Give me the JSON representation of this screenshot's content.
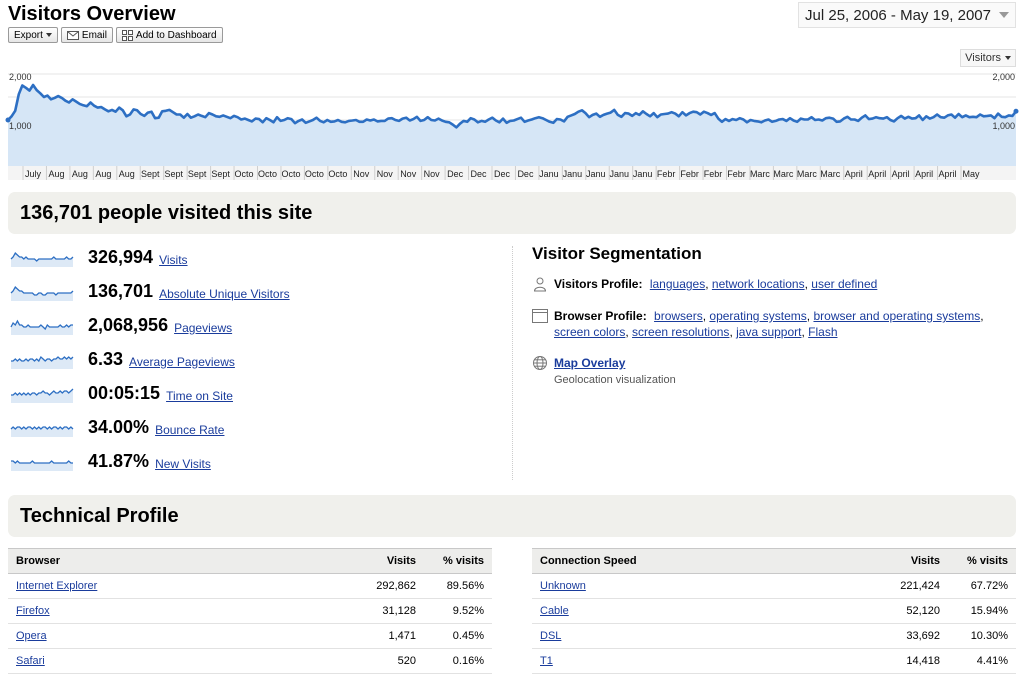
{
  "header": {
    "title": "Visitors Overview",
    "date_range": "Jul 25, 2006 - May 19, 2007",
    "metric_select": "Visitors"
  },
  "toolbar": {
    "export": "Export",
    "email": "Email",
    "add_dashboard": "Add to Dashboard"
  },
  "chart_data": {
    "type": "area",
    "series": [
      {
        "name": "Visitors",
        "values": [
          1000,
          1080,
          1200,
          1560,
          1750,
          1700,
          1640,
          1760,
          1650,
          1580,
          1500,
          1530,
          1450,
          1480,
          1520,
          1480,
          1420,
          1380,
          1450,
          1400,
          1350,
          1320,
          1300,
          1380,
          1310,
          1270,
          1280,
          1230,
          1190,
          1220,
          1180,
          1270,
          1210,
          1080,
          1120,
          1230,
          1210,
          1130,
          1090,
          1160,
          1180,
          1040,
          1050,
          1190,
          1200,
          1220,
          1170,
          1120,
          1120,
          1050,
          1130,
          1050,
          1080,
          1120,
          1090,
          1060,
          1150,
          1120,
          1080,
          1070,
          1100,
          1070,
          1040,
          1090,
          1060,
          1010,
          1030,
          1000,
          970,
          1030,
          1020,
          950,
          1040,
          1000,
          950,
          1060,
          980,
          1000,
          1040,
          1020,
          930,
          980,
          1010,
          940,
          970,
          1000,
          1050,
          980,
          950,
          1000,
          960,
          970,
          1000,
          960,
          950,
          980,
          990,
          1000,
          960,
          960,
          1010,
          990,
          1010,
          970,
          980,
          980,
          1030,
          1040,
          1000,
          980,
          1030,
          1050,
          990,
          1020,
          1070,
          980,
          1000,
          1060,
          1000,
          990,
          1030,
          990,
          960,
          950,
          900,
          840,
          920,
          980,
          960,
          1040,
          1010,
          950,
          980,
          960,
          1010,
          1050,
          990,
          950,
          1030,
          940,
          980,
          990,
          1020,
          1050,
          960,
          990,
          1010,
          1040,
          1060,
          1040,
          1000,
          960,
          940,
          1020,
          1010,
          970,
          1070,
          1100,
          1130,
          1180,
          1210,
          1150,
          1060,
          1110,
          1140,
          1070,
          1110,
          1140,
          1160,
          1220,
          1110,
          1070,
          1150,
          1140,
          1090,
          1150,
          1110,
          1190,
          1130,
          1080,
          1150,
          1060,
          1120,
          1130,
          1140,
          1170,
          1140,
          1080,
          1170,
          1100,
          1150,
          1180,
          1170,
          1120,
          1180,
          1150,
          1110,
          1150,
          1030,
          960,
          1020,
          980,
          1020,
          1000,
          1040,
          1010,
          950,
          1000,
          980,
          970,
          950,
          990,
          1010,
          960,
          980,
          1010,
          1020,
          980,
          1040,
          990,
          960,
          1030,
          1010,
          1010,
          1060,
          1000,
          1010,
          990,
          1040,
          1050,
          1030,
          960,
          970,
          1030,
          1070,
          1010,
          1010,
          980,
          1050,
          1100,
          1020,
          1030,
          1060,
          1040,
          1030,
          1060,
          1000,
          970,
          1040,
          1090,
          1030,
          1070,
          1030,
          1040,
          1100,
          1000,
          1080,
          1030,
          1060,
          1120,
          1060,
          1050,
          1100,
          1120,
          1050,
          1130,
          1060,
          1100,
          1060,
          1070,
          1060,
          1120,
          1080,
          1090,
          1100,
          1040,
          1140,
          1070,
          1060,
          1100,
          1090,
          1190
        ]
      }
    ],
    "ylim": [
      0,
      2000
    ],
    "y_ticks_left": [
      "2,000",
      "1,000"
    ],
    "y_ticks_right": [
      "2,000",
      "1,000"
    ],
    "x_tick_labels": [
      "July",
      "Aug",
      "Aug",
      "Aug",
      "Aug",
      "Sept",
      "Sept",
      "Sept",
      "Sept",
      "Octo",
      "Octo",
      "Octo",
      "Octo",
      "Octo",
      "Nov",
      "Nov",
      "Nov",
      "Nov",
      "Dec",
      "Dec",
      "Dec",
      "Dec",
      "Janu",
      "Janu",
      "Janu",
      "Janu",
      "Janu",
      "Febr",
      "Febr",
      "Febr",
      "Febr",
      "Marc",
      "Marc",
      "Marc",
      "Marc",
      "April",
      "April",
      "April",
      "April",
      "April",
      "May"
    ],
    "grid": true,
    "color": "#2d6fc3"
  },
  "visited_banner": "136,701 people visited this site",
  "metrics": [
    {
      "value": "326,994",
      "label": "Visits",
      "spark": [
        5,
        6,
        8,
        7,
        6,
        6,
        5,
        6,
        5,
        5,
        5,
        5,
        4,
        5,
        5,
        5,
        5,
        5,
        5,
        5,
        6,
        5,
        5,
        5,
        5,
        5,
        6,
        5,
        5,
        6
      ]
    },
    {
      "value": "136,701",
      "label": "Absolute Unique Visitors",
      "spark": [
        5,
        6,
        8,
        7,
        6,
        6,
        5,
        5,
        5,
        5,
        5,
        4,
        4,
        5,
        5,
        4,
        4,
        5,
        5,
        5,
        5,
        4,
        5,
        5,
        5,
        5,
        5,
        5,
        5,
        6
      ]
    },
    {
      "value": "2,068,956",
      "label": "Pageviews",
      "spark": [
        5,
        7,
        6,
        8,
        6,
        6,
        5,
        5,
        6,
        5,
        5,
        5,
        5,
        5,
        6,
        5,
        4,
        6,
        5,
        5,
        5,
        5,
        5,
        6,
        5,
        5,
        6,
        5,
        6,
        6
      ]
    },
    {
      "value": "6.33",
      "label": "Average Pageviews",
      "spark": [
        5,
        5,
        6,
        5,
        6,
        5,
        5,
        6,
        5,
        6,
        6,
        5,
        6,
        5,
        7,
        6,
        5,
        6,
        6,
        5,
        6,
        6,
        7,
        6,
        6,
        7,
        6,
        7,
        6,
        7
      ]
    },
    {
      "value": "00:05:15",
      "label": "Time on Site",
      "spark": [
        5,
        5,
        6,
        5,
        6,
        5,
        6,
        5,
        6,
        5,
        6,
        6,
        5,
        6,
        6,
        7,
        6,
        6,
        5,
        6,
        7,
        6,
        6,
        7,
        6,
        7,
        7,
        6,
        7,
        8
      ]
    },
    {
      "value": "34.00%",
      "label": "Bounce Rate",
      "spark": [
        5,
        6,
        5,
        6,
        6,
        5,
        6,
        5,
        6,
        6,
        5,
        6,
        5,
        6,
        5,
        6,
        6,
        5,
        6,
        5,
        6,
        6,
        5,
        6,
        5,
        6,
        6,
        5,
        6,
        5
      ]
    },
    {
      "value": "41.87%",
      "label": "New Visits",
      "spark": [
        6,
        6,
        5,
        6,
        5,
        5,
        5,
        5,
        5,
        5,
        6,
        5,
        5,
        5,
        5,
        5,
        5,
        5,
        5,
        6,
        5,
        5,
        5,
        5,
        5,
        5,
        5,
        6,
        5,
        5
      ]
    }
  ],
  "segmentation": {
    "title": "Visitor Segmentation",
    "visitors_profile": {
      "label": "Visitors Profile:",
      "links": [
        "languages",
        "network locations",
        "user defined"
      ]
    },
    "browser_profile": {
      "label": "Browser Profile:",
      "links": [
        "browsers",
        "operating systems",
        "browser and operating systems",
        "screen colors",
        "screen resolutions",
        "java support",
        "Flash"
      ]
    },
    "map_overlay": {
      "label": "Map Overlay",
      "sub": "Geolocation visualization"
    }
  },
  "technical_profile": {
    "title": "Technical Profile",
    "browser_table": {
      "headers": [
        "Browser",
        "Visits",
        "% visits"
      ],
      "rows": [
        [
          "Internet Explorer",
          "292,862",
          "89.56%"
        ],
        [
          "Firefox",
          "31,128",
          "9.52%"
        ],
        [
          "Opera",
          "1,471",
          "0.45%"
        ],
        [
          "Safari",
          "520",
          "0.16%"
        ]
      ]
    },
    "connection_table": {
      "headers": [
        "Connection Speed",
        "Visits",
        "% visits"
      ],
      "rows": [
        [
          "Unknown",
          "221,424",
          "67.72%"
        ],
        [
          "Cable",
          "52,120",
          "15.94%"
        ],
        [
          "DSL",
          "33,692",
          "10.30%"
        ],
        [
          "T1",
          "14,418",
          "4.41%"
        ]
      ]
    }
  }
}
